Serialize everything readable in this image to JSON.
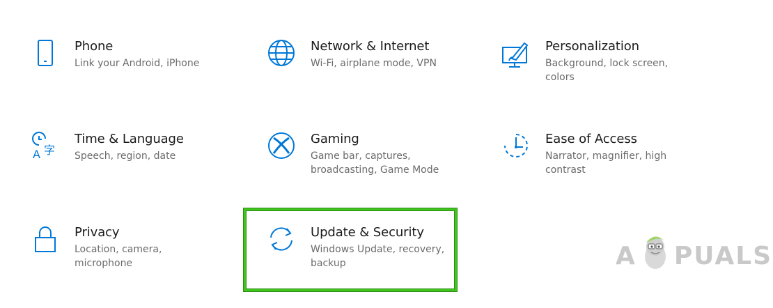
{
  "tiles": {
    "phone": {
      "title": "Phone",
      "desc": "Link your Android, iPhone",
      "icon": "phone-icon"
    },
    "network": {
      "title": "Network & Internet",
      "desc": "Wi-Fi, airplane mode, VPN",
      "icon": "globe-icon"
    },
    "personalization": {
      "title": "Personalization",
      "desc": "Background, lock screen, colors",
      "icon": "paint-monitor-icon"
    },
    "time": {
      "title": "Time & Language",
      "desc": "Speech, region, date",
      "icon": "time-language-icon"
    },
    "gaming": {
      "title": "Gaming",
      "desc": "Game bar, captures, broadcasting, Game Mode",
      "icon": "xbox-icon"
    },
    "ease": {
      "title": "Ease of Access",
      "desc": "Narrator, magnifier, high contrast",
      "icon": "ease-of-access-icon"
    },
    "privacy": {
      "title": "Privacy",
      "desc": "Location, camera, microphone",
      "icon": "lock-icon"
    },
    "update": {
      "title": "Update & Security",
      "desc": "Windows Update, recovery, backup",
      "icon": "sync-icon"
    }
  },
  "watermark": {
    "left": "A",
    "right": "PUALS"
  },
  "colors": {
    "accent": "#0078d7",
    "highlight": "#41c41f"
  }
}
